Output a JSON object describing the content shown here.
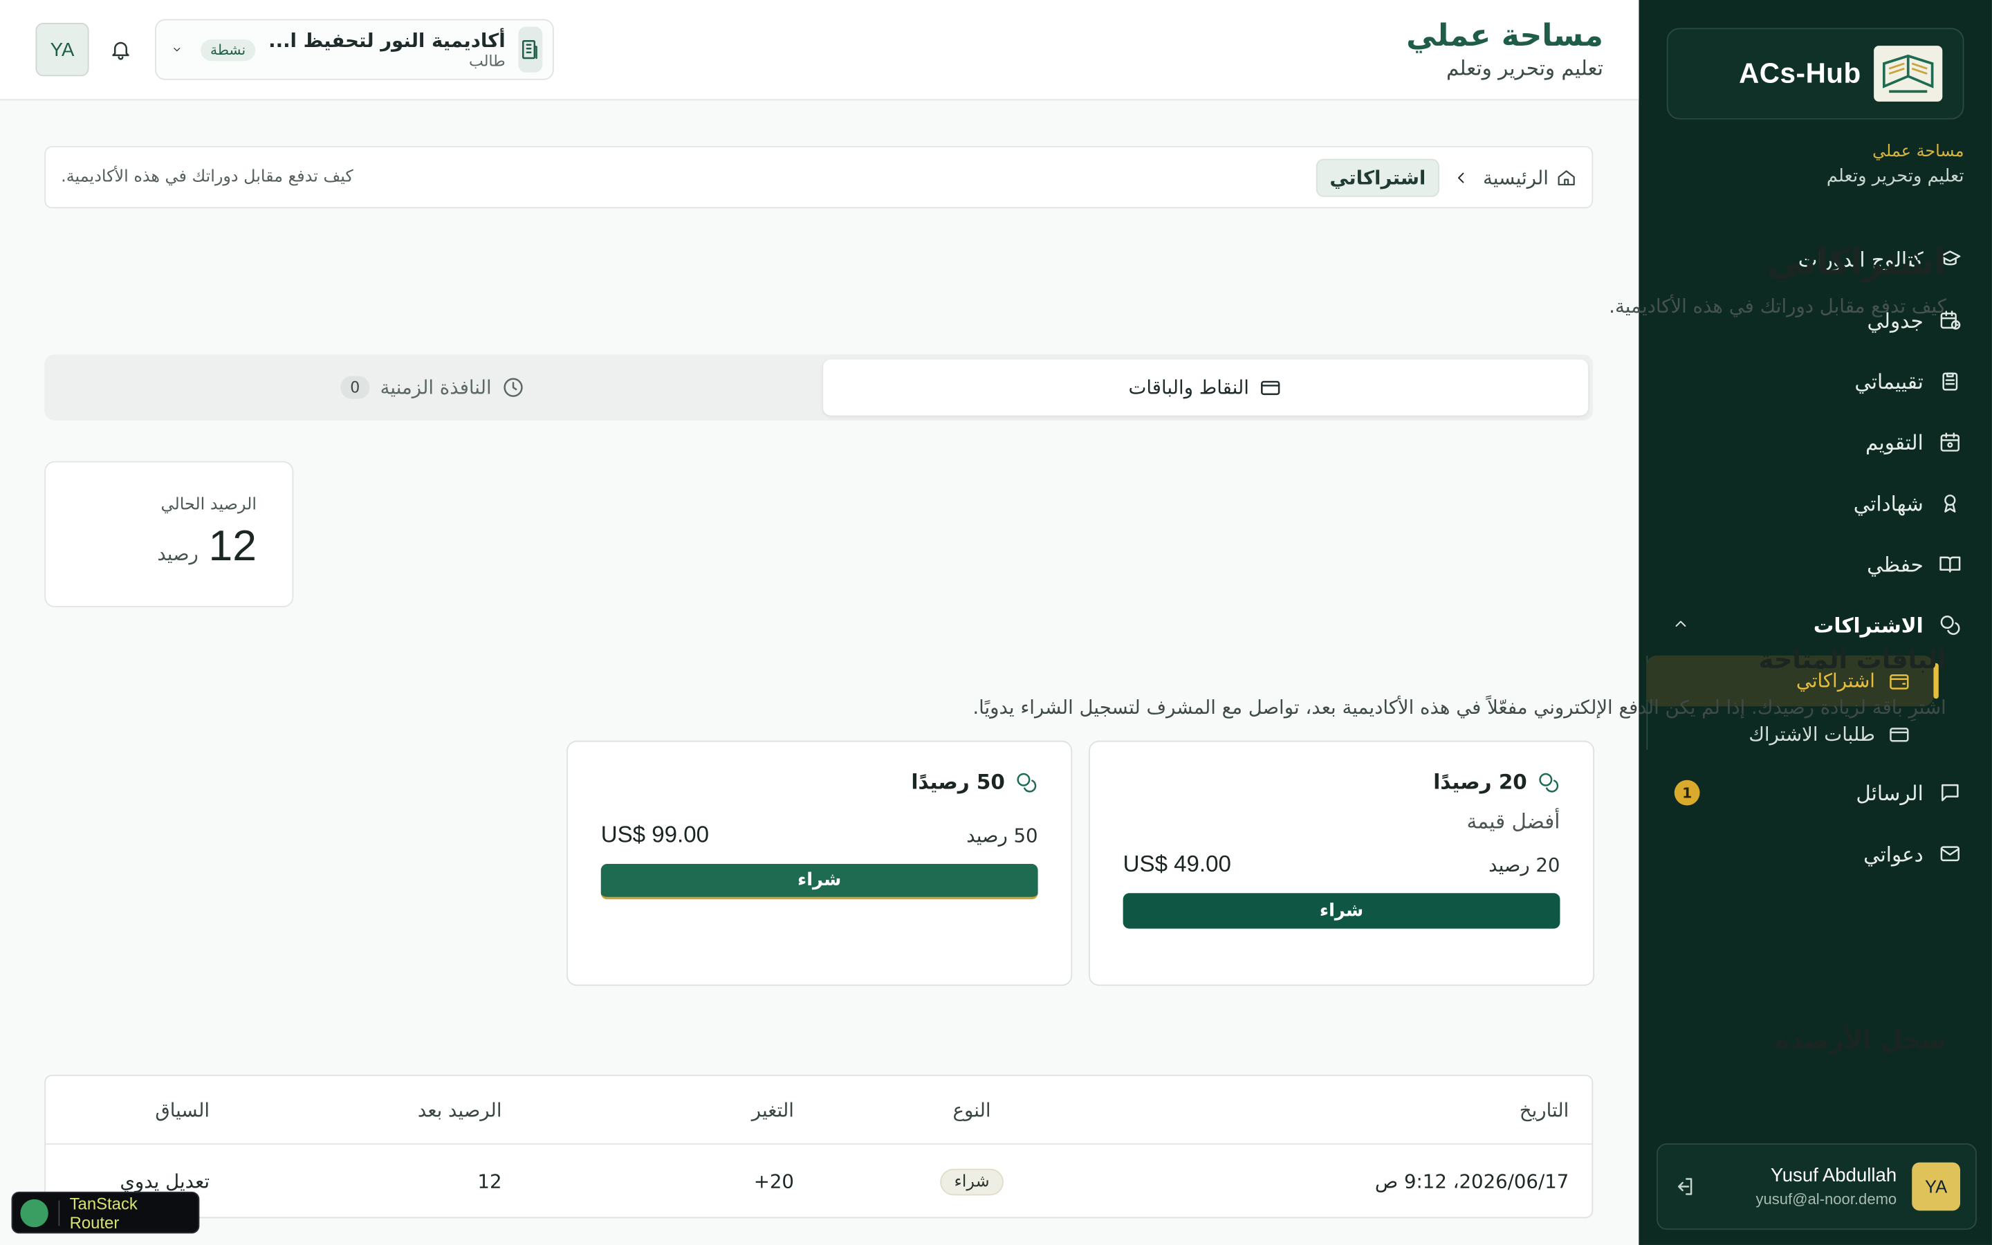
{
  "sidebar": {
    "brand": "ACs-Hub",
    "workspace_label": "مساحة عملي",
    "workspace_tagline": "تعليم وتحرير وتعلم",
    "items": [
      {
        "label": "كتالوج الدورات",
        "icon": "graduation-cap-icon"
      },
      {
        "label": "جدولي",
        "icon": "calendar-clock-icon"
      },
      {
        "label": "تقييماتي",
        "icon": "clipboard-icon"
      },
      {
        "label": "التقويم",
        "icon": "calendar-icon"
      },
      {
        "label": "شهاداتي",
        "icon": "award-icon"
      },
      {
        "label": "حفظي",
        "icon": "book-open-icon"
      }
    ],
    "group": {
      "label": "الاشتراكات",
      "icon": "coins-icon"
    },
    "sub_items": [
      {
        "label": "اشتراكاتي",
        "icon": "wallet-icon"
      },
      {
        "label": "طلبات الاشتراك",
        "icon": "credit-card-icon"
      }
    ],
    "messages": {
      "label": "الرسائل",
      "badge": "1",
      "icon": "message-icon"
    },
    "invitations": {
      "label": "دعواتي",
      "icon": "mail-icon"
    },
    "user": {
      "name": "Yusuf Abdullah",
      "email": "yusuf@al-noor.demo",
      "initials": "YA"
    }
  },
  "header": {
    "title": "مساحة عملي",
    "subtitle": "تعليم وتحرير وتعلم",
    "academy_name": "أكاديمية النور لتحفيظ ا...",
    "academy_role": "طالب",
    "academy_status": "نشطة",
    "user_initials": "YA"
  },
  "breadcrumb": {
    "home": "الرئيسية",
    "current": "اشتراكاتي",
    "description": "كيف تدفع مقابل دوراتك في هذه الأكاديمية."
  },
  "page": {
    "title": "اشتراكاتي",
    "subtitle": "كيف تدفع مقابل دوراتك في هذه الأكاديمية."
  },
  "tabs": [
    {
      "label": "النقاط والباقات"
    },
    {
      "label": "النافذة الزمنية",
      "count": "0"
    }
  ],
  "balance": {
    "label": "الرصيد الحالي",
    "value": "12",
    "unit": "رصيد"
  },
  "packages": {
    "title": "الباقات المتاحة",
    "subtitle": "اشترِ باقة لزيادة رصيدك. إذا لم يكن الدفع الإلكتروني مفعّلاً في هذه الأكاديمية بعد، تواصل مع المشرف لتسجيل الشراء يدويًا.",
    "items": [
      {
        "name": "20 رصيدًا",
        "tag": "أفضل قيمة",
        "credits": "20 رصيد",
        "price": "US$ 49.00",
        "buy": "شراء"
      },
      {
        "name": "50 رصيدًا",
        "tag": "",
        "credits": "50 رصيد",
        "price": "US$ 99.00",
        "buy": "شراء"
      }
    ]
  },
  "ledger": {
    "title": "سجل الأرصدة",
    "columns": [
      "التاريخ",
      "النوع",
      "التغير",
      "الرصيد بعد",
      "السياق"
    ],
    "rows": [
      {
        "date": "2026/06/17، 9:12 ص",
        "type": "شراء",
        "change": "+20",
        "after": "12",
        "context": "تعديل يدوي"
      }
    ]
  },
  "devtools": {
    "label": "TanStack Router"
  },
  "colors": {
    "sidebar_bg": "#0d2a22",
    "accent_gold": "#e6be3d",
    "primary_green": "#0f5744"
  }
}
